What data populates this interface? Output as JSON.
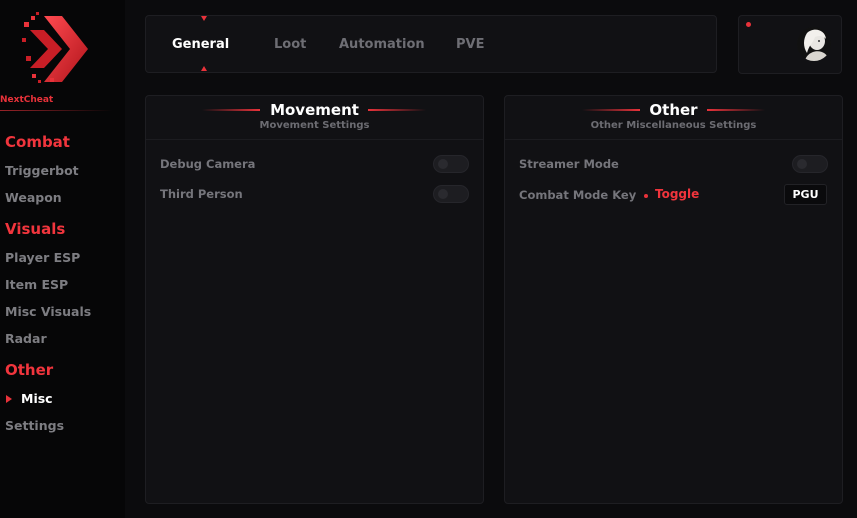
{
  "brand": {
    "name": "NextCheat",
    "accent": "#e8323a"
  },
  "sidebar": {
    "sections": [
      {
        "title": "Combat",
        "items": [
          "Triggerbot",
          "Weapon"
        ]
      },
      {
        "title": "Visuals",
        "items": [
          "Player ESP",
          "Item ESP",
          "Misc Visuals",
          "Radar"
        ]
      },
      {
        "title": "Other",
        "items": [
          "Misc",
          "Settings"
        ]
      }
    ],
    "active_item": "Misc"
  },
  "tabs": {
    "items": [
      "General",
      "Loot",
      "Automation",
      "PVE"
    ],
    "active": "General"
  },
  "profile": {
    "icon": "user-avatar",
    "status": "online-dot"
  },
  "panels": {
    "movement": {
      "title": "Movement",
      "subtitle": "Movement Settings",
      "rows": [
        {
          "label": "Debug Camera",
          "enabled": false
        },
        {
          "label": "Third Person",
          "enabled": false
        }
      ]
    },
    "other": {
      "title": "Other",
      "subtitle": "Other Miscellaneous Settings",
      "streamer_mode": {
        "label": "Streamer Mode",
        "enabled": false
      },
      "combat_mode_key": {
        "label": "Combat Mode Key",
        "mode": "Toggle",
        "key": "PGU"
      }
    }
  }
}
